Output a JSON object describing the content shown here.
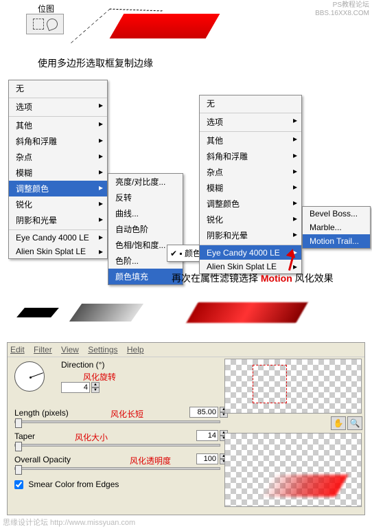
{
  "watermark": {
    "line1": "PS教程论坛",
    "line2": "BBS.16XX8.COM",
    "bottom": "思缘设计论坛   http://www.missyuan.com"
  },
  "top": {
    "bitmap_label": "位图",
    "caption1": "使用多边形选取框复制边缘"
  },
  "menu1": {
    "none": "无",
    "options": "选项",
    "other": "其他",
    "bevel": "斜角和浮雕",
    "noise": "杂点",
    "blur": "模糊",
    "adjust_color": "调整颜色",
    "sharpen": "锐化",
    "shadow_glow": "阴影和光晕",
    "eye_candy": "Eye Candy 4000 LE",
    "alien": "Alien Skin Splat LE"
  },
  "menu2": {
    "bc": "亮度/对比度...",
    "invert": "反转",
    "curves": "曲线...",
    "auto_levels": "自动色阶",
    "hsl": "色相/饱和度...",
    "levels": "色阶...",
    "color_fill": "颜色填充"
  },
  "menu3_check": "颜色填充",
  "menu4": {
    "none": "无",
    "options": "选项",
    "other": "其他",
    "bevel": "斜角和浮雕",
    "noise": "杂点",
    "blur": "模糊",
    "adjust_color": "调整颜色",
    "sharpen": "锐化",
    "shadow_glow": "阴影和光晕",
    "eye_candy": "Eye Candy 4000 LE",
    "alien": "Alien Skin Splat LE"
  },
  "menu5": {
    "bevel_boss": "Bevel Boss...",
    "marble": "Marble...",
    "motion_trail": "Motion Trail..."
  },
  "annotation": {
    "pre": "再次在属性滤镜选择 ",
    "word": "Motion",
    "post": " 风化效果"
  },
  "dialog": {
    "menubar": {
      "edit": "Edit",
      "filter": "Filter",
      "view": "View",
      "settings": "Settings",
      "help": "Help"
    },
    "direction_label": "Direction (°)",
    "direction_note": "风化旋转",
    "direction_value": "4",
    "length_label": "Length (pixels)",
    "length_note": "风化长短",
    "length_value": "85.00",
    "taper_label": "Taper",
    "taper_note": "风化大小",
    "taper_value": "14",
    "opacity_label": "Overall Opacity",
    "opacity_note": "风化透明度",
    "opacity_value": "100",
    "smear": "Smear Color from Edges",
    "hand": "✋",
    "zoom": "🔍"
  }
}
